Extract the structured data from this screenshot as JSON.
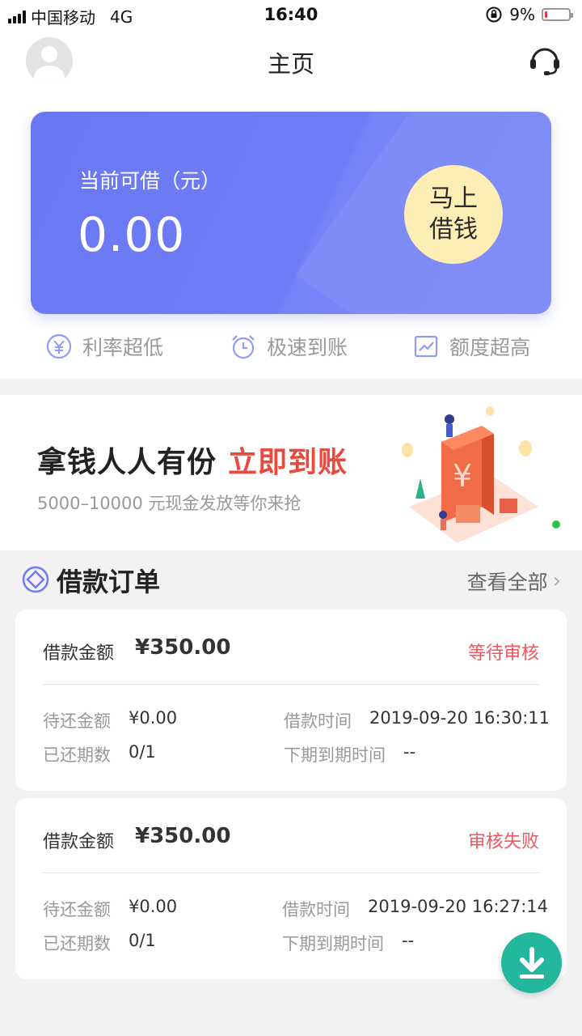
{
  "status_bar": {
    "carrier": "中国移动",
    "network": "4G",
    "time": "16:40",
    "battery": "9%",
    "battery_level": 0.09
  },
  "nav": {
    "title": "主页",
    "avatar_icon": "user-avatar-icon",
    "support_icon": "headset-icon"
  },
  "loan_card": {
    "label": "当前可借（元）",
    "amount": "0.00",
    "button_line1": "马上",
    "button_line2": "借钱",
    "color_from": "#6a78f3",
    "button_color": "#fdeeb5"
  },
  "features": [
    {
      "label": "利率超低",
      "icon": "yen-circle-icon"
    },
    {
      "label": "极速到账",
      "icon": "alarm-clock-icon"
    },
    {
      "label": "额度超高",
      "icon": "trend-chart-icon"
    }
  ],
  "banner": {
    "title_main": "拿钱人人有份",
    "title_accent": "立即到账",
    "subtitle": "5000–10000 元现金发放等你来抢",
    "accent_color": "#e94a3f"
  },
  "orders": {
    "title": "借款订单",
    "view_all": "查看全部",
    "items": [
      {
        "amount_label": "借款金额",
        "amount": "¥350.00",
        "status": "等待审核",
        "remaining_label": "待还金额",
        "remaining": "¥0.00",
        "time_label": "借款时间",
        "time": "2019-09-20 16:30:11",
        "periods_label": "已还期数",
        "periods": "0/1",
        "next_due_label": "下期到期时间",
        "next_due": "--"
      },
      {
        "amount_label": "借款金额",
        "amount": "¥350.00",
        "status": "审核失败",
        "remaining_label": "待还金额",
        "remaining": "¥0.00",
        "time_label": "借款时间",
        "time": "2019-09-20 16:27:14",
        "periods_label": "已还期数",
        "periods": "0/1",
        "next_due_label": "下期到期时间",
        "next_due": "--"
      }
    ]
  },
  "download_icon": "download-arrow-icon",
  "colors": {
    "status_red": "#f0565f",
    "fab_green": "#23b89d"
  }
}
